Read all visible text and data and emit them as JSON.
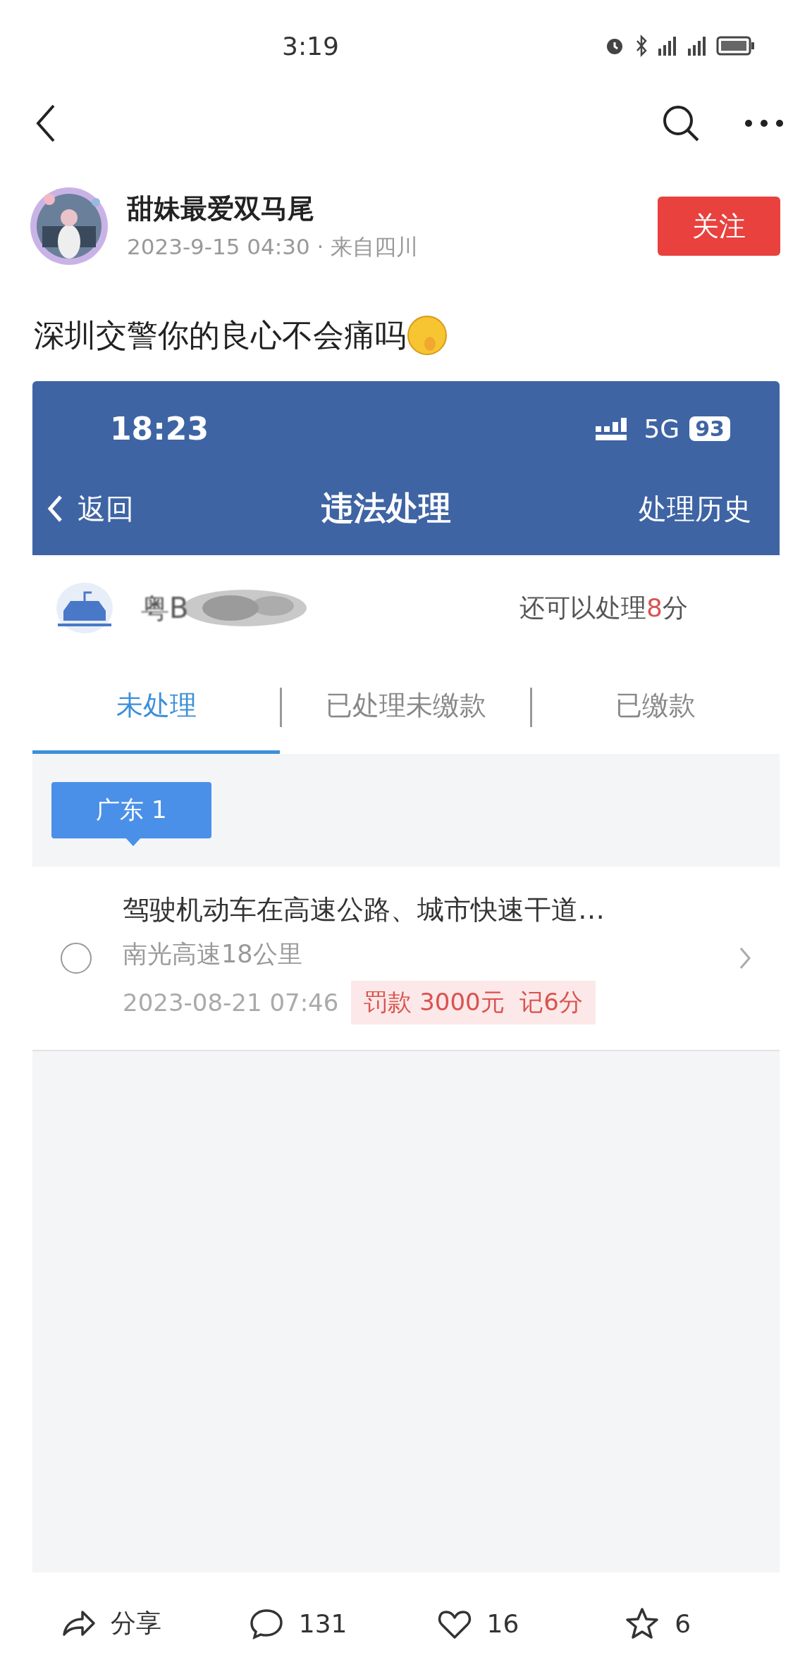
{
  "status_bar": {
    "time": "3:19"
  },
  "author": {
    "name": "甜妹最爱双马尾",
    "meta": "2023-9-15 04:30 · 来自四川",
    "follow_label": "关注"
  },
  "post": {
    "text": "深圳交警你的良心不会痛吗"
  },
  "shot": {
    "status_time": "18:23",
    "network": "5G",
    "battery": "93",
    "back_label": "返回",
    "title": "违法处理",
    "history_label": "处理历史",
    "plate": "粤B",
    "points_prefix": "还可以处理",
    "points_value": "8",
    "points_suffix": "分",
    "tabs": [
      {
        "label": "未处理",
        "selected": true
      },
      {
        "label": "已处理未缴款",
        "selected": false
      },
      {
        "label": "已缴款",
        "selected": false
      }
    ],
    "region_badge": "广东 1",
    "items": [
      {
        "title": "驾驶机动车在高速公路、城市快速干道…",
        "place": "南光高速18公里",
        "time": "2023-08-21 07:46",
        "penalty": "罚款 3000元  记6分",
        "checked": false
      }
    ]
  },
  "actions": [
    {
      "kind": "share",
      "label": "分享"
    },
    {
      "kind": "comment",
      "label": "131"
    },
    {
      "kind": "like",
      "label": "16"
    },
    {
      "kind": "star",
      "label": "6"
    }
  ]
}
